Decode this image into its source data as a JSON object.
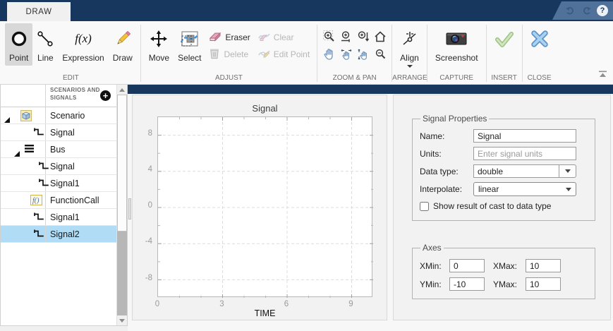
{
  "titlebar": {
    "tab": "DRAW",
    "help": "?"
  },
  "ribbon": {
    "edit": {
      "label": "EDIT",
      "point": "Point",
      "line": "Line",
      "expression": "Expression",
      "draw": "Draw"
    },
    "adjust": {
      "label": "ADJUST",
      "move": "Move",
      "select": "Select",
      "eraser": "Eraser",
      "delete": "Delete",
      "clear": "Clear",
      "edit_point": "Edit Point"
    },
    "zoom_pan": {
      "label": "ZOOM & PAN"
    },
    "arrange": {
      "label": "ARRANGE",
      "align": "Align"
    },
    "capture": {
      "label": "CAPTURE",
      "screenshot": "Screenshot"
    },
    "insert": {
      "label": "INSERT"
    },
    "close": {
      "label": "CLOSE"
    }
  },
  "tree": {
    "header": "SCENARIOS AND SIGNALS",
    "add_icon": "+",
    "items": [
      {
        "label": "Scenario",
        "icon": "scenario-cube",
        "level": 0,
        "expanded": true,
        "selected": false
      },
      {
        "label": "Signal",
        "icon": "signal-step",
        "level": 1,
        "selected": false
      },
      {
        "label": "Bus",
        "icon": "bus",
        "level": 1,
        "expanded": true,
        "selected": false
      },
      {
        "label": "Signal",
        "icon": "signal-step",
        "level": 2,
        "selected": false
      },
      {
        "label": "Signal1",
        "icon": "signal-step",
        "level": 2,
        "selected": false
      },
      {
        "label": "FunctionCall",
        "icon": "function-call",
        "level": 1,
        "selected": false
      },
      {
        "label": "Signal1",
        "icon": "signal-step",
        "level": 1,
        "selected": false
      },
      {
        "label": "Signal2",
        "icon": "signal-step",
        "level": 1,
        "selected": true
      }
    ]
  },
  "chart_data": {
    "type": "line",
    "title": "Signal",
    "xlabel": "TIME",
    "ylabel": "",
    "xlim": [
      0,
      10
    ],
    "ylim": [
      -10,
      10
    ],
    "xticks": [
      0,
      3,
      6,
      9
    ],
    "yticks_top_to_bottom": [
      8,
      4,
      0,
      -4,
      -8
    ],
    "minor_xticks": [
      1,
      2,
      4,
      5,
      7,
      8,
      10
    ],
    "minor_yticks": [
      -10,
      -6,
      -2,
      2,
      6,
      10
    ],
    "grid": "dashed",
    "legend_position": "none",
    "series": []
  },
  "props": {
    "signal": {
      "title": "Signal Properties",
      "name_label": "Name:",
      "name_value": "Signal",
      "units_label": "Units:",
      "units_placeholder": "Enter signal units",
      "data_type_label": "Data type:",
      "data_type_value": "double",
      "interpolate_label": "Interpolate:",
      "interpolate_value": "linear",
      "cast_checkbox_label": "Show result of cast to data type",
      "cast_checked": false
    },
    "axes": {
      "title": "Axes",
      "xmin_label": "XMin:",
      "xmin": "0",
      "xmax_label": "XMax:",
      "xmax": "10",
      "ymin_label": "YMin:",
      "ymin": "-10",
      "ymax_label": "YMax:",
      "ymax": "10"
    }
  },
  "colors": {
    "accent_navy": "#17375f",
    "selection_blue": "#b0dcf5",
    "ribbon_bg": "#f9f9f9",
    "panel_bg": "#f2f2f2"
  }
}
